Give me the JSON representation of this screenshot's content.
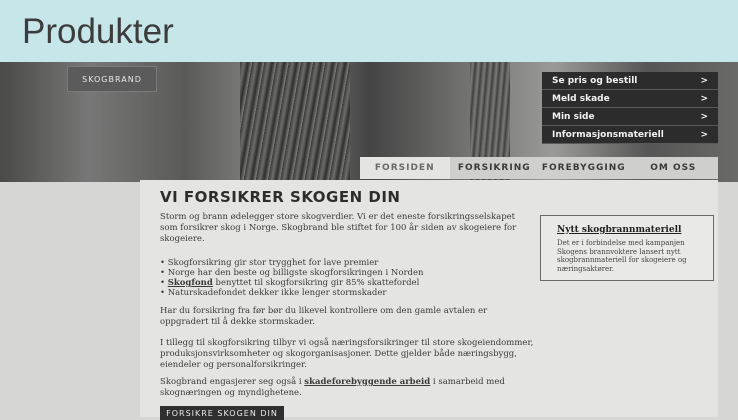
{
  "slide": {
    "title": "Produkter"
  },
  "header": {
    "logo": "SKOGBRAND"
  },
  "quick_links": [
    "Se pris og bestill",
    "Meld skade",
    "Min side",
    "Informasjonsmateriell"
  ],
  "quick_arrow": ">",
  "tabs": [
    "FORSIDEN",
    "FORSIKRING",
    "FOREBYGGING",
    "OM OSS"
  ],
  "main": {
    "heading": "VI FORSIKRER SKOGEN DIN",
    "intro": "Storm og brann ødelegger store skogverdier. Vi er det eneste forsikringsselskapet som forsikrer skog i Norge. Skogbrand ble stiftet for 100 år siden av skogeiere for skogeiere.",
    "bullets": [
      "Skogforsikring gir stor trygghet for lave premier",
      "Norge har den beste og billigste skogforsikringen i Norden"
    ],
    "bullet3_link": "Skogfond",
    "bullet3_text": " benyttet til skogforsikring gir 85% skattefordel",
    "bullet4": "Naturskadefondet dekker ikke lenger stormskader",
    "para2": "Har du forsikring fra før bør du likevel kontrollere om den gamle avtalen er oppgradert til å dekke stormskader.",
    "para3": "I tillegg til skogforsikring tilbyr vi også næringsforsikringer til store skogeiendommer, produksjonsvirksomheter og skogorganisasjoner. Dette gjelder både næringsbygg, eiendeler og personalforsikringer.",
    "para4_a": "Skogbrand engasjerer seg også i ",
    "para4_link": "skadeforebyggende arbeid",
    "para4_b": " i samarbeid med skognæringen og myndighetene.",
    "cta": "FORSIKRE SKOGEN DIN"
  },
  "sidebox": {
    "title": "Nytt skogbrannmateriell",
    "text": "Det er i forbindelse med kampanjen Skogens brannvoktere lansert nytt skogbrannmateriell for skogeiere og næringsaktører."
  }
}
